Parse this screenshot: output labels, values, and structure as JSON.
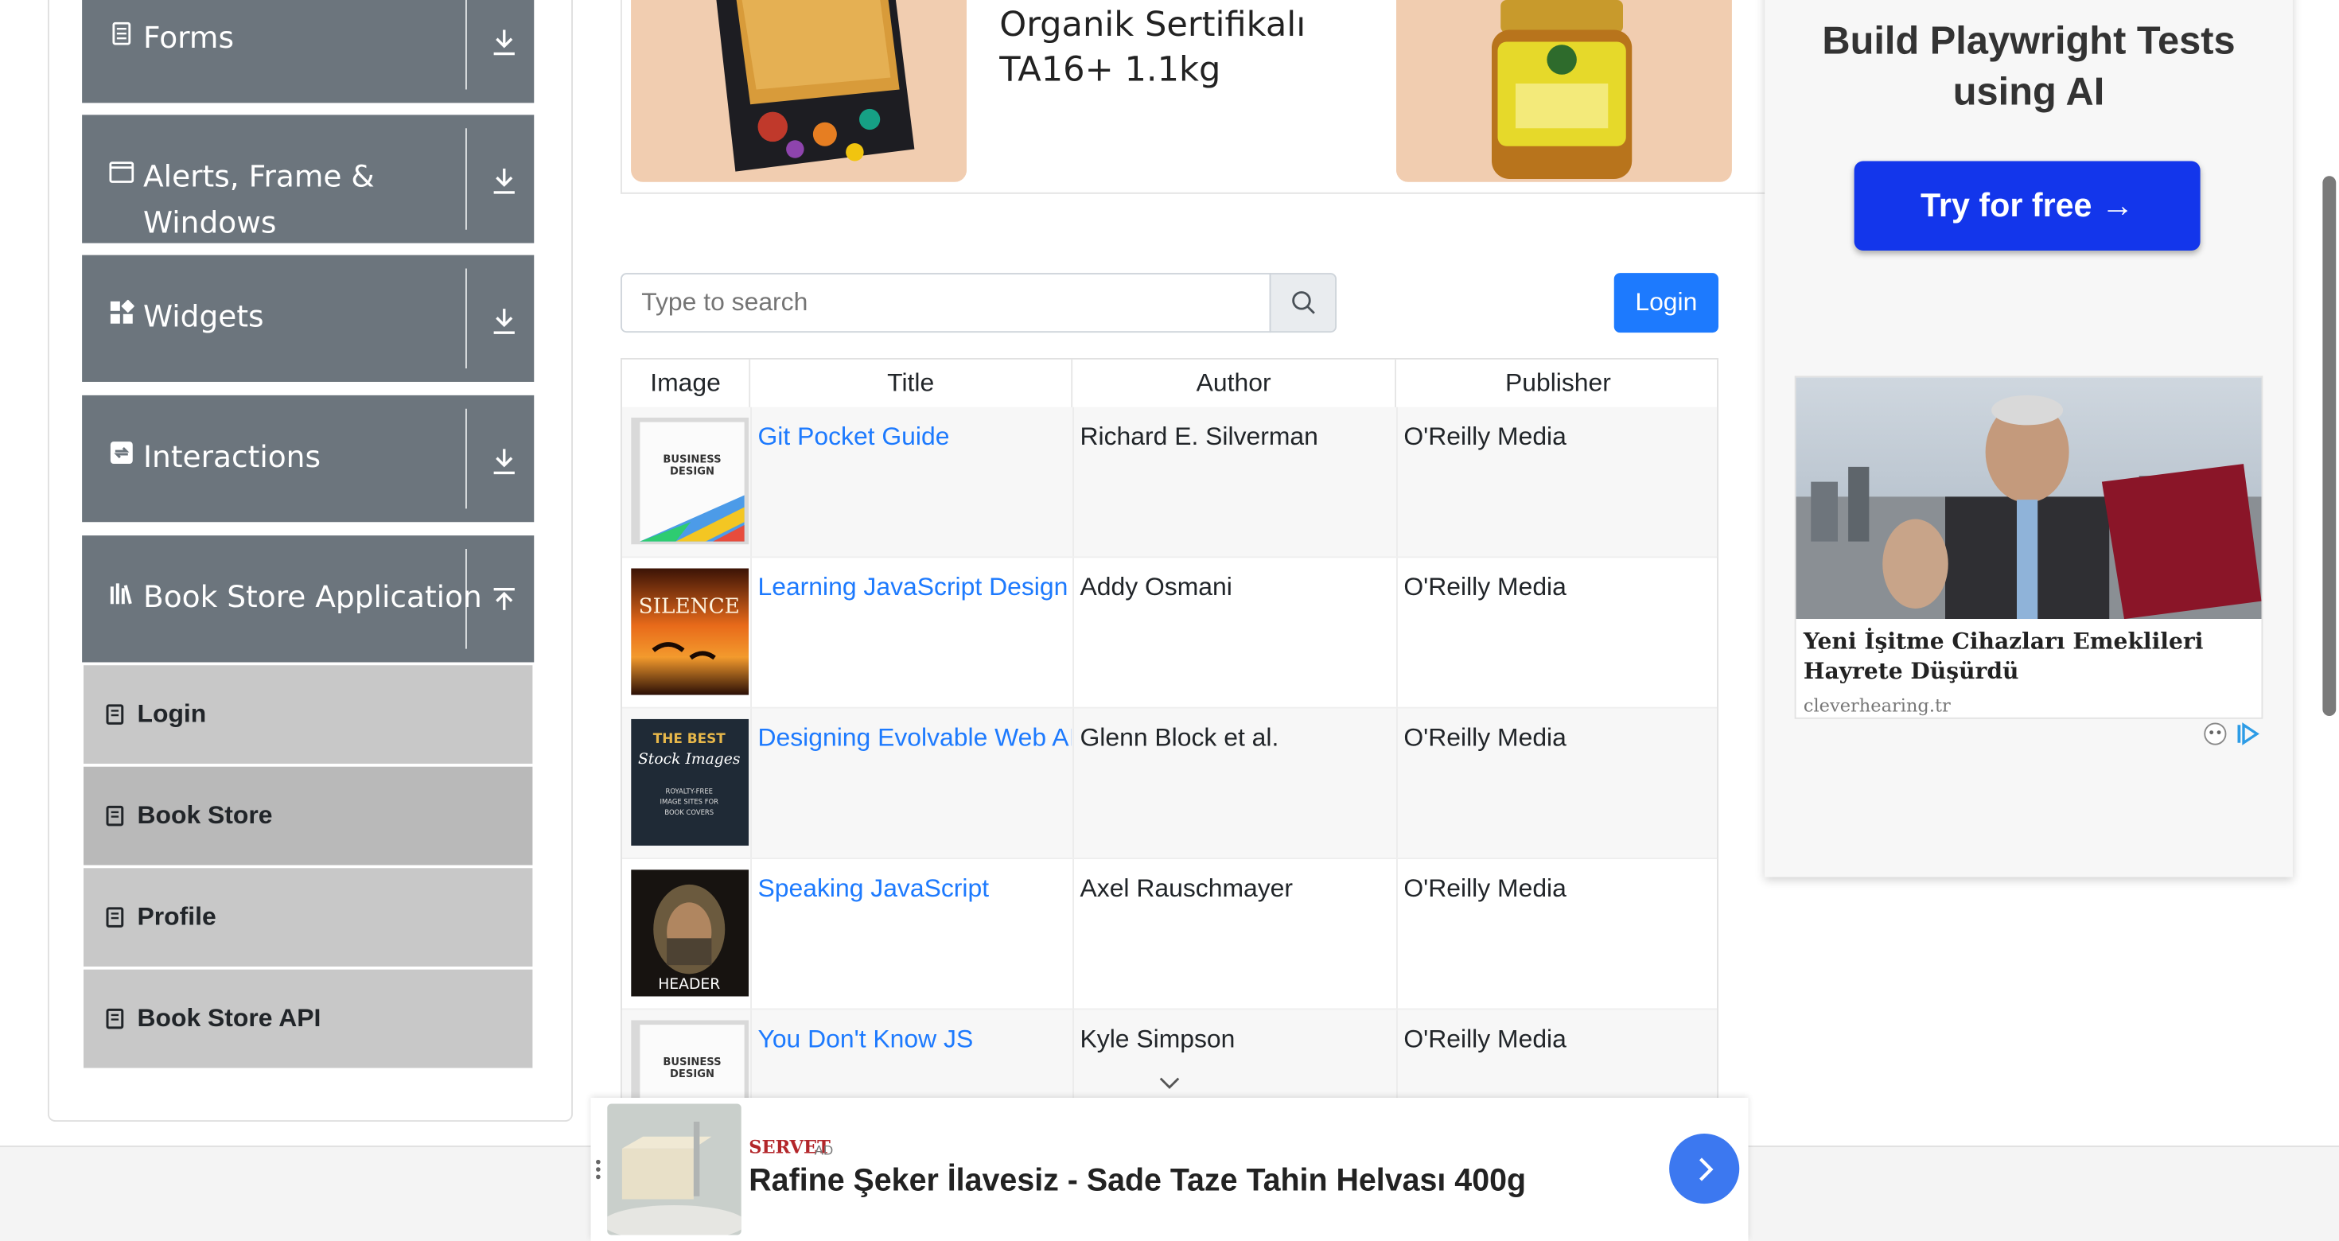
{
  "sidebar": {
    "groups": [
      {
        "label": "Forms",
        "icon": "form-icon",
        "expanded": false
      },
      {
        "label": "Alerts, Frame &",
        "label2": "Windows",
        "icon": "window-icon",
        "expanded": false
      },
      {
        "label": "Widgets",
        "icon": "widgets-icon",
        "expanded": false
      },
      {
        "label": "Interactions",
        "icon": "interactions-icon",
        "expanded": false
      },
      {
        "label": "Book Store Application",
        "icon": "library-icon",
        "expanded": true
      }
    ],
    "items": [
      {
        "label": "Login"
      },
      {
        "label": "Book Store",
        "active": true
      },
      {
        "label": "Profile"
      },
      {
        "label": "Book Store API"
      }
    ]
  },
  "product": {
    "title_line1": "Organik Sertifikalı",
    "title_line2": "TA16+ 1.1kg"
  },
  "search": {
    "placeholder": "Type to search",
    "login_label": "Login"
  },
  "table": {
    "headers": [
      "Image",
      "Title",
      "Author",
      "Publisher"
    ],
    "rows": [
      {
        "title": "Git Pocket Guide",
        "author": "Richard E. Silverman",
        "publisher": "O'Reilly Media",
        "cover": "business-design"
      },
      {
        "title": "Learning JavaScript Design Patterns",
        "author": "Addy Osmani",
        "publisher": "O'Reilly Media",
        "cover": "silence"
      },
      {
        "title": "Designing Evolvable Web APIs with ASP.NET",
        "author": "Glenn Block et al.",
        "publisher": "O'Reilly Media",
        "cover": "best-stock"
      },
      {
        "title": "Speaking JavaScript",
        "author": "Axel Rauschmayer",
        "publisher": "O'Reilly Media",
        "cover": "header"
      },
      {
        "title": "You Don't Know JS",
        "author": "Kyle Simpson",
        "publisher": "O'Reilly Media",
        "cover": "business-design"
      }
    ],
    "cover_texts": {
      "business_design": "BUSINESS DESIGN",
      "silence": "SILENCE",
      "best_stock": "THE BEST",
      "best_stock_sub": "Stock Images",
      "best_stock_small": "ROYALTY-FREE IMAGE SITES FOR BOOK COVERS",
      "header": "HEADER"
    }
  },
  "right_ad": {
    "title": "Build Playwright Tests using AI",
    "cta": "Try for free →",
    "headline": "Yeni İşitme Cihazları Emeklileri Hayrete Düşürdü",
    "domain": "cleverhearing.tr"
  },
  "bottom_ad": {
    "brand": "SERVET",
    "tag": "AD",
    "title": "Rafine Şeker İlavesiz - Sade Taze Tahin Helvası 400g"
  },
  "colors": {
    "sidebar_header": "#6c757d",
    "sidebar_item": "#c8c8c8",
    "link": "#1d7afe",
    "login_button": "#1d7afe",
    "cta_button": "#1336eb"
  }
}
